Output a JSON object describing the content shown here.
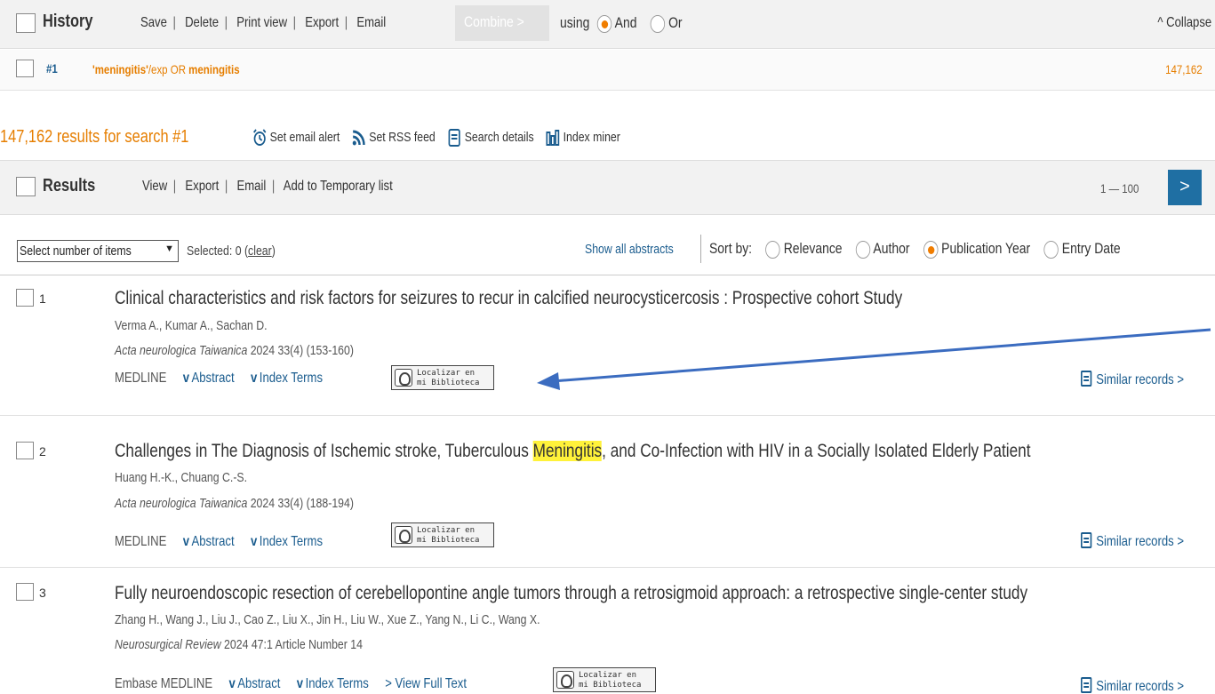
{
  "history": {
    "title": "History",
    "actions": [
      "Save",
      "Delete",
      "Print view",
      "Export",
      "Email"
    ],
    "combine_label": "Combine >",
    "using_label": "using",
    "and_label": "And",
    "or_label": "Or",
    "collapse_label": "^ Collapse",
    "row": {
      "number": "#1",
      "query_term1": "'meningitis'",
      "query_mid": "/exp OR ",
      "query_term2": "meningitis",
      "count": "147,162"
    }
  },
  "results_summary": {
    "count_text": "147,162 results for search #1",
    "tools": {
      "email_alert": "Set email alert",
      "rss": "Set RSS feed",
      "details": "Search details",
      "miner": "Index miner"
    }
  },
  "results_bar": {
    "title": "Results",
    "actions": [
      "View",
      "Export",
      "Email",
      "Add to Temporary list"
    ],
    "range": "1 — 100",
    "next": ">"
  },
  "options": {
    "select_items": "Select number of items",
    "selected_prefix": "Selected: 0 (",
    "clear": "clear",
    "selected_suffix": ")",
    "show_abstracts": "Show all abstracts",
    "sort_by": "Sort by:",
    "sort_options": [
      "Relevance",
      "Author",
      "Publication Year",
      "Entry Date"
    ],
    "sort_selected": "Publication Year"
  },
  "records": [
    {
      "num": "1",
      "title_pre": "Clinical characteristics and risk factors for seizures to recur in calcified neurocysticercosis : Prospective cohort Study",
      "title_hl": "",
      "title_post": "",
      "authors": "Verma A., Kumar A., Sachan D.",
      "journal": "Acta neurologica Taiwanica",
      "citation": " 2024 33(4) (153-160)",
      "sources": "MEDLINE",
      "abstract": "Abstract",
      "index_terms": "Index Terms",
      "full_text": "",
      "badge_line1": "Localizar  en",
      "badge_line2": "mi Biblioteca",
      "similar": "Similar records >"
    },
    {
      "num": "2",
      "title_pre": "Challenges in The Diagnosis of Ischemic stroke, Tuberculous ",
      "title_hl": "Meningitis",
      "title_post": ", and Co-Infection with HIV in a Socially Isolated Elderly Patient",
      "authors": "Huang H.-K., Chuang C.-S.",
      "journal": "Acta neurologica Taiwanica",
      "citation": " 2024 33(4) (188-194)",
      "sources": "MEDLINE",
      "abstract": "Abstract",
      "index_terms": "Index Terms",
      "full_text": "",
      "badge_line1": "Localizar  en",
      "badge_line2": "mi Biblioteca",
      "similar": "Similar records >"
    },
    {
      "num": "3",
      "title_pre": "Fully neuroendoscopic resection of cerebellopontine angle tumors through a retrosigmoid approach: a retrospective single-center study",
      "title_hl": "",
      "title_post": "",
      "authors": "Zhang H., Wang J., Liu J., Cao Z., Liu X., Jin H., Liu W., Xue Z., Yang N., Li C., Wang X.",
      "journal": "Neurosurgical Review",
      "citation": " 2024 47:1 Article Number 14",
      "sources": "Embase  MEDLINE",
      "abstract": "Abstract",
      "index_terms": "Index Terms",
      "full_text": "> View Full Text",
      "badge_line1": "Localizar  en",
      "badge_line2": "mi Biblioteca",
      "similar": "Similar records >"
    }
  ],
  "colors": {
    "accent_orange": "#e67e00",
    "link_blue": "#1a5c8e",
    "next_button": "#1f6fa3",
    "highlight": "#fff23a",
    "annotation_arrow": "#3b6cc0"
  }
}
